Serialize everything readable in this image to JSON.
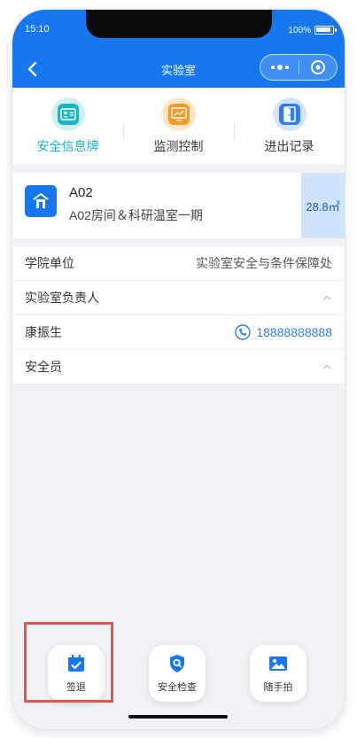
{
  "status_bar": {
    "time": "15:10",
    "battery_text": "100%"
  },
  "nav": {
    "title": "实验室",
    "back_icon": "chevron-left-icon",
    "more_icon": "more-dots-icon",
    "close_icon": "target-circle-icon"
  },
  "tabs": [
    {
      "label": "安全信息牌",
      "icon": "id-card-icon",
      "active": true,
      "color": "#1bb4c4"
    },
    {
      "label": "监测控制",
      "icon": "monitor-chart-icon",
      "active": false,
      "color": "#f59a23"
    },
    {
      "label": "进出记录",
      "icon": "door-icon",
      "active": false,
      "color": "#2f7fe6"
    }
  ],
  "room": {
    "code": "A02",
    "name": "A02房间＆科研温室一期",
    "area": "28.8㎡",
    "icon": "building-icon"
  },
  "info": {
    "college_label": "学院单位",
    "college_value": "实验室安全与条件保障处",
    "manager_label": "实验室负责人",
    "manager_name": "康振生",
    "manager_phone": "18888888888",
    "safety_officer_label": "安全员"
  },
  "dock": [
    {
      "label": "签退",
      "icon": "calendar-check-icon"
    },
    {
      "label": "安全检查",
      "icon": "shield-search-icon"
    },
    {
      "label": "随手拍",
      "icon": "image-icon"
    }
  ],
  "colors": {
    "primary": "#1677f1",
    "teal": "#1bb4c4",
    "highlight": "#e4534e"
  }
}
